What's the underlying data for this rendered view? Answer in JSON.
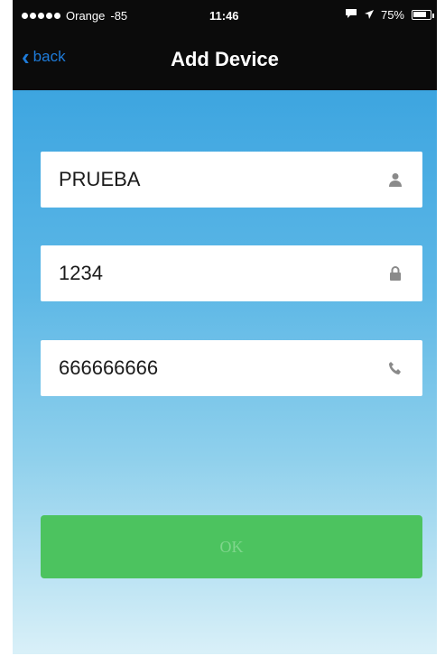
{
  "status_bar": {
    "carrier": "Orange",
    "signal_strength": "-85",
    "time": "11:46",
    "battery": "75%"
  },
  "nav": {
    "back_label": "back",
    "title": "Add Device"
  },
  "form": {
    "name_value": "PRUEBA",
    "password_value": "1234",
    "phone_value": "666666666"
  },
  "actions": {
    "ok_label": "OK"
  },
  "colors": {
    "accent_blue": "#1e7bd9",
    "ok_green": "#4cc35f",
    "icon_gray": "#8a8a8a"
  }
}
